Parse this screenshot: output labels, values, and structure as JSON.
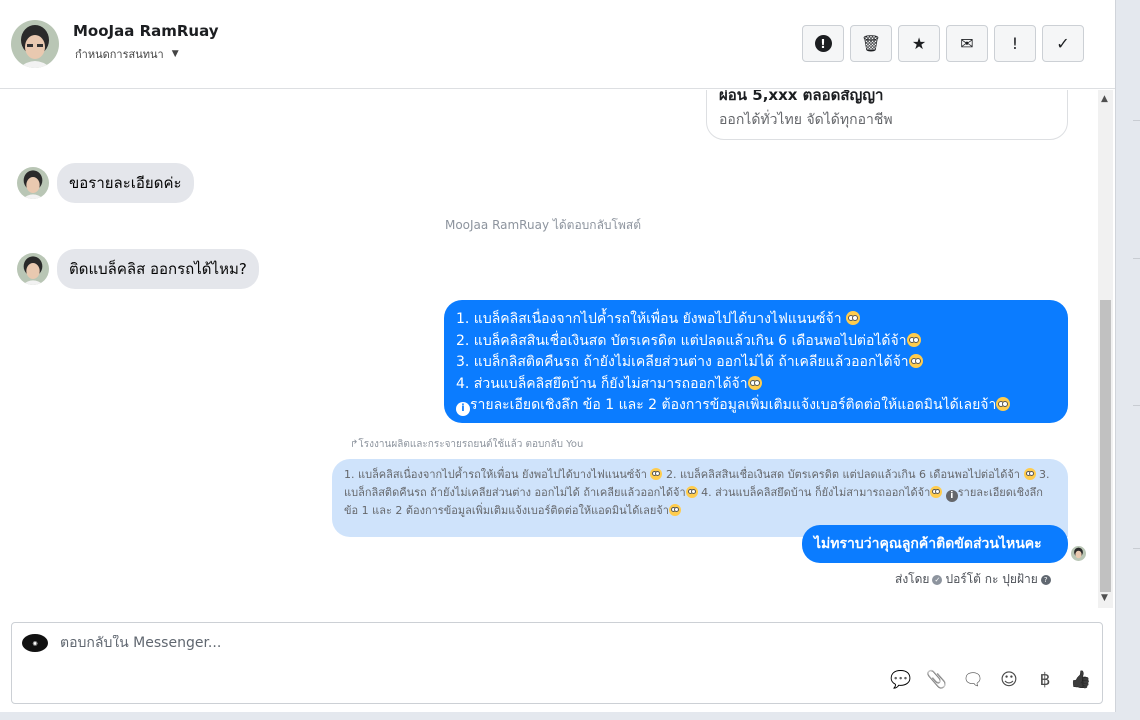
{
  "header": {
    "contact_name": "MooJaa RamRuay",
    "assign_label": "กำหนดการสนทนา",
    "toolbar": [
      {
        "name": "spam-button",
        "glyph": "!",
        "icon": "alert-circle-icon"
      },
      {
        "name": "delete-button",
        "glyph": "🗑",
        "icon": "trash-icon"
      },
      {
        "name": "star-button",
        "glyph": "★",
        "icon": "star-icon"
      },
      {
        "name": "mark-unread-button",
        "glyph": "✉",
        "icon": "envelope-icon"
      },
      {
        "name": "follow-up-button",
        "glyph": "!",
        "icon": "exclamation-icon"
      },
      {
        "name": "mark-done-button",
        "glyph": "✓",
        "icon": "check-icon"
      }
    ]
  },
  "post_card": {
    "line1": "ผ่อน 5,xxx ตลอดสัญญา",
    "line2": "ออกได้ทั่วไทย จัดได้ทุกอาชีพ"
  },
  "messages": {
    "in1": "ขอรายละเอียดค่ะ",
    "system_note": "MooJaa RamRuay ได้ตอบกลับโพสต์",
    "in2": "ติดแบล็คลิส ออกรถได้ไหม?",
    "out_big": {
      "line1": "1. แบล็คลิสเนื่องจากไปค้ำรถให้เพื่อน ยังพอไปได้บางไฟแนนซ์จ้า",
      "line2": "2. แบล็คลิสสินเชื่อเงินสด บัตรเครดิต แต่ปลดแล้วเกิน 6 เดือนพอไปต่อได้จ้า",
      "line3": "3. แบล็กลิสติดคืนรถ ถ้ายังไม่เคลียส่วนต่าง ออกไม่ได้ ถ้าเคลียแล้วออกได้จ้า",
      "line4": "4. ส่วนแบล็คลิสยึดบ้าน ก็ยังไม่สามารถออกได้จ้า",
      "line5": "รายละเอียดเชิงลึก ข้อ 1 และ 2 ต้องการข้อมูลเพิ่มเติมแจ้งเบอร์ติดต่อให้แอดมินได้เลยจ้า"
    },
    "reply_label": "โรงงานผลิตและกระจายรถยนต์ใช้แล้ว ตอบกลับ You",
    "quoted": {
      "p1": "1. แบล็คลิสเนื่องจากไปค้ำรถให้เพื่อน ยังพอไปได้บางไฟแนนซ์จ้า",
      "p2": " 2. แบล็คลิสสินเชื่อเงินสด บัตรเครดิต แต่ปลดแล้วเกิน 6 เดือนพอไปต่อได้จ้า",
      "p3": " 3. แบล็กลิสติดคืนรถ ถ้ายังไม่เคลียส่วนต่าง ออกไม่ได้ ถ้าเคลียแล้วออกได้จ้า",
      "p4": " 4. ส่วนแบล็คลิสยึดบ้าน ก็ยังไม่สามารถออกได้จ้า",
      "p5": "รายละเอียดเชิงลึก ข้อ 1 และ 2 ต้องการข้อมูลเพิ่มเติมแจ้งเบอร์ติดต่อให้แอดมินได้เลยจ้า"
    },
    "out_small": "ไม่ทราบว่าคุณลูกค้าติดขัดส่วนไหนคะ",
    "sent_by_prefix": "ส่งโดย",
    "sent_by_name": "ปอร์โต้ กะ ปุยฝ้าย"
  },
  "composer": {
    "placeholder": "ตอบกลับใน Messenger...",
    "tools": [
      {
        "name": "saved-reply-button",
        "glyph": "💬",
        "icon": "saved-reply-icon"
      },
      {
        "name": "attach-button",
        "glyph": "📎",
        "icon": "paperclip-icon"
      },
      {
        "name": "quick-reply-button",
        "glyph": "🗨",
        "icon": "chat-dots-icon"
      },
      {
        "name": "emoji-button",
        "glyph": "☺",
        "icon": "smiley-icon"
      },
      {
        "name": "payment-button",
        "glyph": "฿",
        "icon": "baht-icon"
      },
      {
        "name": "like-button",
        "glyph": "👍",
        "icon": "thumbs-up-icon"
      }
    ]
  },
  "colors": {
    "bubble_out": "#0b7cff",
    "bubble_in": "#e4e6eb",
    "quoted_bg": "#cfe3fb"
  }
}
